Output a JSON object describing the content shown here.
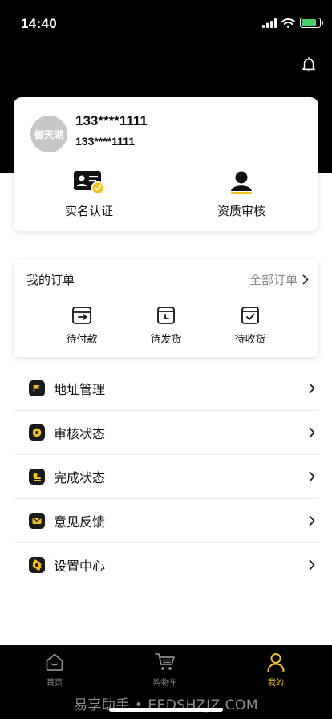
{
  "status_bar": {
    "time": "14:40",
    "battery_level": 0.8
  },
  "header": {
    "bell_icon": "bell-icon"
  },
  "profile": {
    "avatar_text": "御天湖",
    "name": "133****1111",
    "phone": "133****1111",
    "actions": [
      {
        "label": "实名认证",
        "icon": "id-card-verified-icon"
      },
      {
        "label": "资质审核",
        "icon": "user-silhouette-icon"
      }
    ]
  },
  "orders": {
    "title": "我的订单",
    "all_label": "全部订单",
    "items": [
      {
        "label": "待付款",
        "icon": "wallet-out-icon"
      },
      {
        "label": "待发货",
        "icon": "box-clock-icon"
      },
      {
        "label": "待收货",
        "icon": "box-check-icon"
      }
    ]
  },
  "menu": [
    {
      "label": "地址管理",
      "icon": "flag-icon"
    },
    {
      "label": "审核状态",
      "icon": "gear-icon"
    },
    {
      "label": "完成状态",
      "icon": "coin-stack-icon"
    },
    {
      "label": "意见反馈",
      "icon": "mail-icon"
    },
    {
      "label": "设置中心",
      "icon": "settings-icon"
    }
  ],
  "tab_bar": {
    "tabs": [
      {
        "label": "首页",
        "icon": "home-icon",
        "active": false
      },
      {
        "label": "购物车",
        "icon": "cart-icon",
        "active": false
      },
      {
        "label": "我的",
        "icon": "person-icon",
        "active": true
      }
    ],
    "watermark": "易享助手 • EEDSHZJZ.COM"
  },
  "colors": {
    "accent": "#f3c11b",
    "dark": "#000000",
    "muted": "#8a8a8a"
  }
}
